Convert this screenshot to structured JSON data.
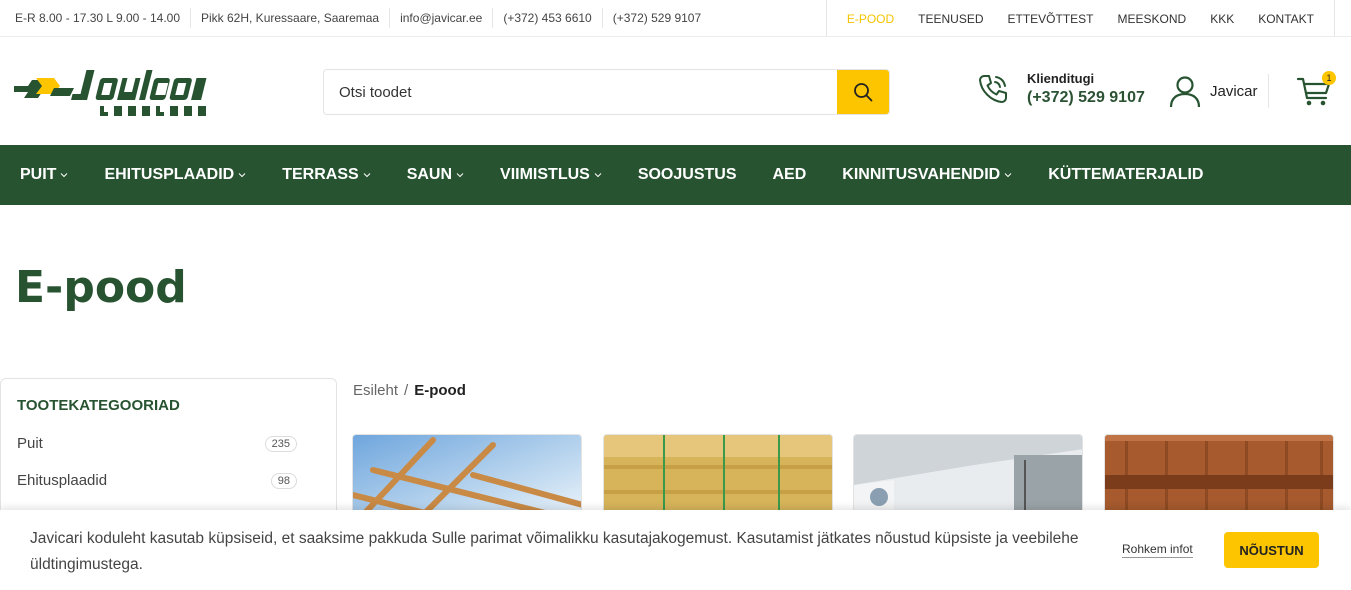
{
  "topbar": {
    "info": [
      "E-R 8.00 - 17.30 L 9.00 - 14.00",
      "Pikk 62H, Kuressaare, Saaremaa",
      "info@javicar.ee",
      "(+372) 453 6610",
      "(+372) 529 9107"
    ],
    "links": [
      {
        "label": "E-POOD",
        "active": true
      },
      {
        "label": "TEENUSED"
      },
      {
        "label": "ETTEVÕTTEST"
      },
      {
        "label": "MEESKOND"
      },
      {
        "label": "KKK"
      },
      {
        "label": "KONTAKT"
      }
    ]
  },
  "logo": {
    "brand": "Javicar",
    "sub": "LAUALADU"
  },
  "search": {
    "placeholder": "Otsi toodet"
  },
  "support": {
    "label": "Klienditugi",
    "phone": "(+372) 529 9107"
  },
  "account": {
    "name": "Javicar"
  },
  "cart": {
    "count": "1"
  },
  "nav": [
    {
      "label": "PUIT",
      "dropdown": true
    },
    {
      "label": "EHITUSPLAADID",
      "dropdown": true
    },
    {
      "label": "TERRASS",
      "dropdown": true
    },
    {
      "label": "SAUN",
      "dropdown": true
    },
    {
      "label": "VIIMISTLUS",
      "dropdown": true
    },
    {
      "label": "SOOJUSTUS",
      "dropdown": false
    },
    {
      "label": "AED",
      "dropdown": false
    },
    {
      "label": "KINNITUSVAHENDID",
      "dropdown": true
    },
    {
      "label": "KÜTTEMATERJALID",
      "dropdown": false
    }
  ],
  "page": {
    "title": "E-pood"
  },
  "sidebar": {
    "heading": "TOOTEKATEGOORIAD",
    "categories": [
      {
        "name": "Puit",
        "count": "235"
      },
      {
        "name": "Ehitusplaadid",
        "count": "98"
      }
    ]
  },
  "breadcrumb": {
    "home": "Esileht",
    "separator": "/",
    "current": "E-pood"
  },
  "cookie": {
    "text": "Javicari koduleht kasutab küpsiseid, et saaksime pakkuda Sulle parimat võimalikku kasutajakogemust. Kasutamist jätkates nõustud küpsiste ja veebilehe üldtingimustega.",
    "more": "Rohkem infot",
    "accept": "NÕUSTUN"
  },
  "colors": {
    "brand_green": "#275331",
    "accent_yellow": "#fcc500"
  }
}
